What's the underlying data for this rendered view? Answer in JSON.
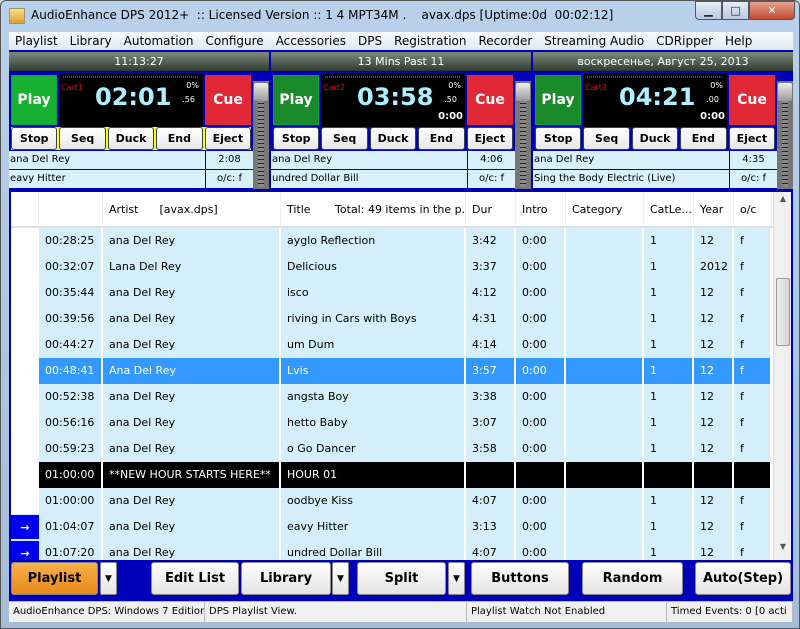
{
  "window": {
    "title": "AudioEnhance DPS 2012+  :: Licensed Version :: 1 4 MPT34M .    avax.dps [Uptime:0d  00:02:12]"
  },
  "menu": [
    "Playlist",
    "Library",
    "Automation",
    "Configure",
    "Accessories",
    "DPS",
    "Registration",
    "Recorder",
    "Streaming Audio",
    "CDRipper",
    "Help"
  ],
  "headers": [
    "11:13:27",
    "13 Mins Past 11",
    "воскресенье,  Август 25,  2013"
  ],
  "decks": [
    {
      "play": "Play",
      "cue": "Cue",
      "cart": "Cart1",
      "time": "02:01",
      "pct": "0%",
      "sub": ".56",
      "remaining": "",
      "buttons": [
        "Stop",
        "Seq",
        "Duck",
        "End",
        "Eject"
      ],
      "artist": "ana Del Rey",
      "dur": "2:08",
      "title": "eavy Hitter",
      "oc": "o/c: f",
      "selected": true
    },
    {
      "play": "Play",
      "cue": "Cue",
      "cart": "Cart2",
      "time": "03:58",
      "pct": "0%",
      "sub": ".50",
      "remaining": "0:00",
      "buttons": [
        "Stop",
        "Seq",
        "Duck",
        "End",
        "Eject"
      ],
      "artist": "ana Del Rey",
      "dur": "4:06",
      "title": "undred Dollar Bill",
      "oc": "o/c: f",
      "selected": false
    },
    {
      "play": "Play",
      "cue": "Cue",
      "cart": "Cart3",
      "time": "04:21",
      "pct": "0%",
      "sub": ".00",
      "remaining": "0:00",
      "buttons": [
        "Stop",
        "Seq",
        "Duck",
        "End",
        "Eject"
      ],
      "artist": "ana Del Rey",
      "dur": "4:35",
      "title": "Sing the Body Electric (Live)",
      "oc": "o/c: f",
      "selected": false
    }
  ],
  "table": {
    "columns": [
      "",
      "",
      "Artist      [avax.dps]",
      "Title       Total: 49 items in the p...",
      "Dur",
      "Intro",
      "Category",
      "CatLe...",
      "Year",
      "o/c"
    ],
    "rows": [
      {
        "cells": [
          "",
          "00:28:25",
          "ana Del Rey",
          "ayglo Reflection",
          "3:42",
          "0:00",
          "",
          "1",
          "12",
          "f"
        ]
      },
      {
        "cells": [
          "",
          "00:32:07",
          "Lana Del Rey",
          "Delicious",
          "3:37",
          "0:00",
          "",
          "1",
          "2012",
          "f"
        ]
      },
      {
        "cells": [
          "",
          "00:35:44",
          "ana Del Rey",
          "isco",
          "4:12",
          "0:00",
          "",
          "1",
          "12",
          "f"
        ]
      },
      {
        "cells": [
          "",
          "00:39:56",
          "ana Del Rey",
          "riving in Cars with Boys",
          "4:31",
          "0:00",
          "",
          "1",
          "12",
          "f"
        ]
      },
      {
        "cells": [
          "",
          "00:44:27",
          "ana Del Rey",
          "um Dum",
          "4:14",
          "0:00",
          "",
          "1",
          "12",
          "f"
        ]
      },
      {
        "cells": [
          "",
          "00:48:41",
          "Ana Del Rey",
          "Lvis",
          "3:57",
          "0:00",
          "",
          "1",
          "12",
          "f"
        ],
        "state": "sel"
      },
      {
        "cells": [
          "",
          "00:52:38",
          "ana Del Rey",
          "angsta Boy",
          "3:38",
          "0:00",
          "",
          "1",
          "12",
          "f"
        ]
      },
      {
        "cells": [
          "",
          "00:56:16",
          "ana Del Rey",
          "hetto Baby",
          "3:07",
          "0:00",
          "",
          "1",
          "12",
          "f"
        ]
      },
      {
        "cells": [
          "",
          "00:59:23",
          "ana Del Rey",
          "o Go Dancer",
          "3:58",
          "0:00",
          "",
          "1",
          "12",
          "f"
        ]
      },
      {
        "cells": [
          "",
          "01:00:00",
          "**NEW HOUR STARTS HERE**",
          "HOUR 01",
          "",
          "",
          "",
          "",
          "",
          ""
        ],
        "state": "hour"
      },
      {
        "cells": [
          "",
          "01:00:00",
          "ana Del Rey",
          "oodbye Kiss",
          "4:07",
          "0:00",
          "",
          "1",
          "12",
          "f"
        ]
      },
      {
        "cells": [
          "→",
          "01:04:07",
          "ana Del Rey",
          "eavy Hitter",
          "3:13",
          "0:00",
          "",
          "1",
          "12",
          "f"
        ],
        "arrow": true
      },
      {
        "cells": [
          "→",
          "01:07:20",
          "ana Del Rey",
          "undred Dollar Bill",
          "4:07",
          "0:00",
          "",
          "1",
          "12",
          "f"
        ],
        "arrow": true
      }
    ]
  },
  "buttons": [
    {
      "label": "Playlist",
      "active": true,
      "dropdown": true
    },
    {
      "label": "Edit List"
    },
    {
      "label": "Library",
      "dropdown": true
    },
    {
      "label": "Split",
      "dropdown": true
    },
    {
      "label": "Buttons"
    },
    {
      "label": "Random"
    },
    {
      "label": "Auto(Step)"
    }
  ],
  "status": [
    "AudioEnhance DPS: Windows 7 Edition",
    "DPS Playlist View.",
    "Playlist Watch Not Enabled",
    "Timed Events: 0 [0 acti"
  ],
  "colors": {
    "play": "#18b030",
    "cue": "#e02836",
    "selected_row": "#3399ff",
    "row_bg": "#d4eff9",
    "frame": "#0000b8",
    "active_button": "#f0a030"
  }
}
